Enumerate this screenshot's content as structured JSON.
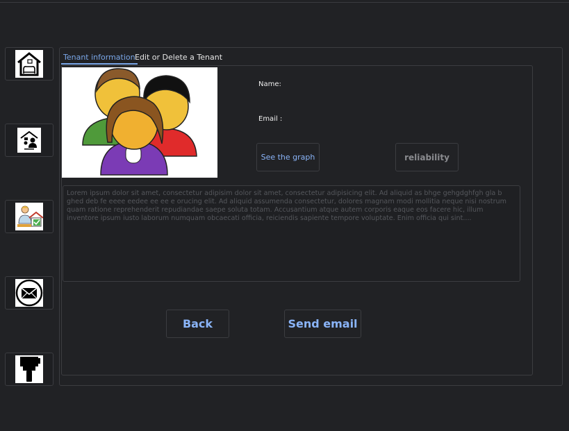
{
  "tabs": {
    "tenant_info": "Tenant information",
    "edit_delete": "Edit or Delete a Tenant"
  },
  "fields": {
    "name_label": "Name:",
    "email_label": "Email :"
  },
  "buttons": {
    "see_graph": "See the graph",
    "reliability": "reliability",
    "back": "Back",
    "send_email": "Send email"
  },
  "description": "Lorem ipsum dolor sit amet, consectetur adipisim dolor sit amet, consectetur adipisicing elit. Ad aliquid as bhge gehgdghfgh gla b  ghed deb fe eeee eedee ee ee e orucing elit. Ad aliquid assumenda consectetur, dolores magnam modi mollitia neque nisi nostrum quam ratione reprehenderit repudiandae saepe soluta totam. Accusantium atque autem corporis eaque eos facere hic, illum inventore ipsum iusto laborum numquam obcaecati officia, reiciendis sapiente tempore voluptate. Enim officia qui sint....",
  "sidebar": {
    "items": [
      {
        "icon": "house-furniture-icon"
      },
      {
        "icon": "tenant-house-icon"
      },
      {
        "icon": "agent-house-check-icon"
      },
      {
        "icon": "envelope-icon"
      },
      {
        "icon": "paint-brush-icon"
      }
    ]
  },
  "colors": {
    "background": "#212225",
    "accent": "#8ab4f8",
    "border": "#3c3d41"
  }
}
